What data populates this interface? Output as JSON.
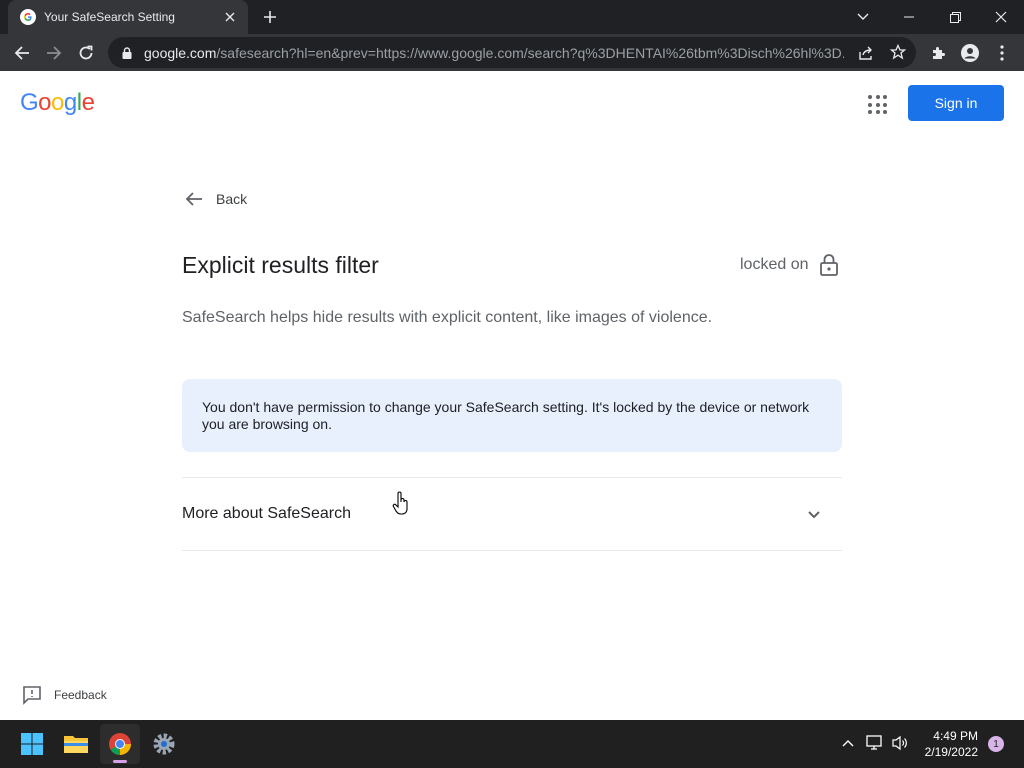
{
  "browser": {
    "tab_title": "Your SafeSearch Setting",
    "url_host": "google.com",
    "url_path": "/safesearch?hl=en&prev=https://www.google.com/search?q%3DHENTAI%26tbm%3Disch%26hl%3D..."
  },
  "header": {
    "logo_letters": [
      "G",
      "o",
      "o",
      "g",
      "l",
      "e"
    ],
    "logo_colors": [
      "#4285F4",
      "#EA4335",
      "#FBBC05",
      "#4285F4",
      "#34A853",
      "#EA4335"
    ],
    "signin_label": "Sign in"
  },
  "content": {
    "back_label": "Back",
    "title": "Explicit results filter",
    "status_label": "locked on",
    "description": "SafeSearch helps hide results with explicit content, like images of violence.",
    "notice": "You don't have permission to change your SafeSearch setting. It's locked by the device or network you are browsing on.",
    "more_label": "More about SafeSearch"
  },
  "footer": {
    "feedback_label": "Feedback"
  },
  "taskbar": {
    "time": "4:49 PM",
    "date": "2/19/2022",
    "notification_count": "1"
  },
  "colors": {
    "accent": "#1a73e8",
    "notice_bg": "#e8f0fe"
  }
}
